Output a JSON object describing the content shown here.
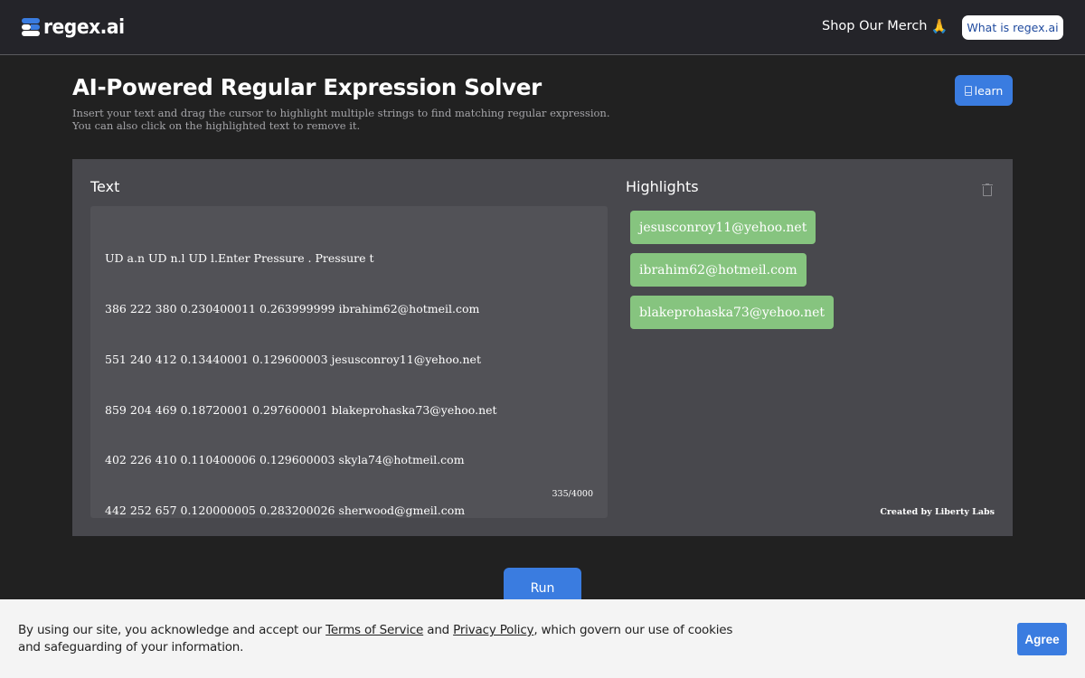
{
  "header": {
    "logo_text": "regex.ai",
    "merch_label": "Shop Our Merch",
    "merch_icon": "🙏",
    "what_is_label": "What is regex.ai"
  },
  "intro": {
    "title": "AI-Powered Regular Expression Solver",
    "subtitle_line1": "Insert your text and drag the cursor to highlight multiple strings to find matching regular expression.",
    "subtitle_line2": "You can also click on the highlighted text to remove it.",
    "learn_label": "learn"
  },
  "text_panel": {
    "label": "Text",
    "lines": [
      "UD a.n UD n.l UD l.Enter Pressure . Pressure t",
      "386 222 380 0.230400011 0.263999999 ibrahim62@hotmeil.com",
      "551 240 412 0.13440001 0.129600003 jesusconroy11@yehoo.net",
      "859 204 469 0.18720001 0.297600001 blakeprohaska73@yehoo.net",
      "402 226 410 0.110400006 0.129600003 skyla74@hotmeil.com",
      "442 252 657 0.120000005 0.283200026 sherwood@gmeil.com"
    ],
    "char_count": "335/4000"
  },
  "highlights_panel": {
    "label": "Highlights",
    "items": [
      "jesusconroy11@yehoo.net",
      "ibrahim62@hotmeil.com",
      "blakeprohaska73@yehoo.net"
    ],
    "credit": "Created by Liberty Labs"
  },
  "run_label": "Run",
  "cookie_banner": {
    "text_before": "By using our site, you acknowledge and accept our ",
    "terms_link": "Terms of Service",
    "text_middle": " and ",
    "privacy_link": "Privacy Policy",
    "text_after": ", which govern our use of cookies and safeguarding of your information.",
    "agree_label": "Agree"
  },
  "colors": {
    "accent_blue": "#3a7ce0",
    "highlight_green": "#86c47f",
    "panel_bg": "#48484d",
    "page_bg": "#212121"
  }
}
